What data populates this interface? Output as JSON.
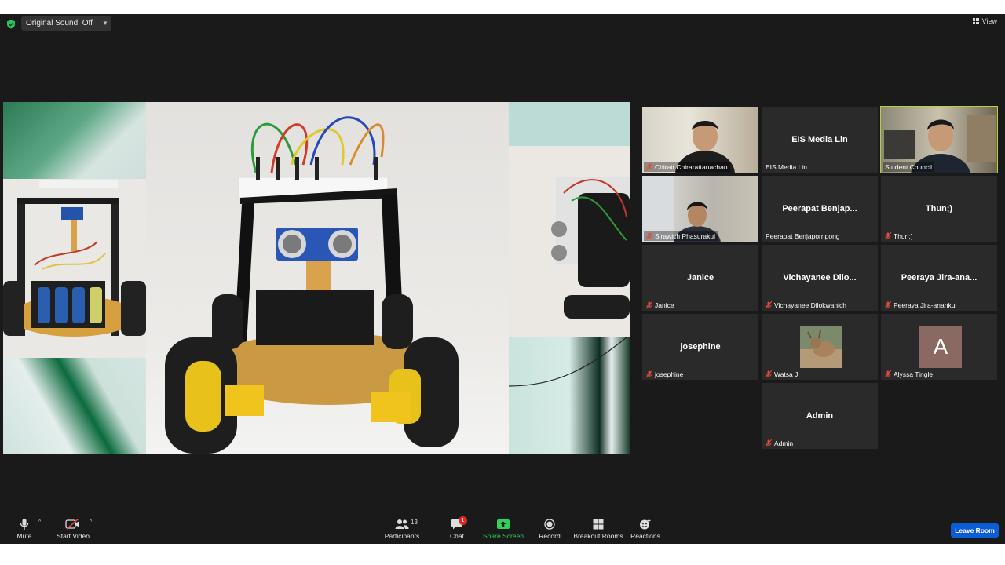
{
  "topbar": {
    "original_sound_label": "Original Sound: Off",
    "view_label": "View",
    "security_color": "#22c55e"
  },
  "gallery": {
    "tiles": [
      {
        "name": "EIS Media Lin",
        "label": "EIS Media Lin",
        "muted": false
      },
      {
        "label": "Chiratt Chirarattanachan",
        "muted": true
      },
      {
        "label": "Student Council",
        "muted": false,
        "active": true
      },
      {
        "label": "Sirawich Phasurakul",
        "muted": true
      },
      {
        "name": "Peerapat  Benjap...",
        "label": "Peerapat Benjapornpong",
        "muted": false
      },
      {
        "name": "Thun;)",
        "label": "Thun;)",
        "muted": true
      },
      {
        "name": "Janice",
        "label": "Janice",
        "muted": true
      },
      {
        "name": "Vichayanee  Dilo...",
        "label": "Vichayanee Dilokwanich",
        "muted": true
      },
      {
        "name": "Peeraya  Jira-ana...",
        "label": "Peeraya Jira-anankul",
        "muted": true
      },
      {
        "name": "josephine",
        "label": "josephine",
        "muted": true
      },
      {
        "label": "Watsa J",
        "muted": true
      },
      {
        "label": "Alyssa Tingle",
        "muted": true,
        "avatar_letter": "A"
      },
      {
        "name": "Admin",
        "label": "Admin",
        "muted": true
      }
    ]
  },
  "toolbar": {
    "mute": "Mute",
    "start_video": "Start Video",
    "participants": "Participants",
    "participants_count": "13",
    "chat": "Chat",
    "chat_badge": "1",
    "share_screen": "Share Screen",
    "record": "Record",
    "breakout_rooms": "Breakout Rooms",
    "reactions": "Reactions",
    "leave_room": "Leave Room"
  }
}
